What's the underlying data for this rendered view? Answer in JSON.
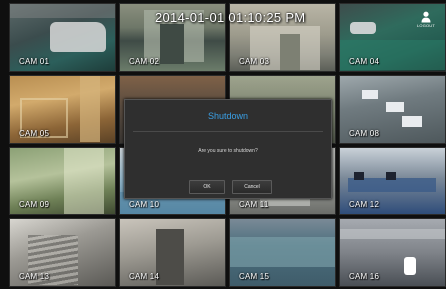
{
  "timestamp": "2014-01-01 01:10:25 PM",
  "logout": {
    "label": "LOGOUT",
    "icon": "user-icon"
  },
  "cameras": [
    {
      "label": "CAM 01"
    },
    {
      "label": "CAM 02"
    },
    {
      "label": "CAM 03"
    },
    {
      "label": "CAM 04"
    },
    {
      "label": "CAM 05"
    },
    {
      "label": ""
    },
    {
      "label": ""
    },
    {
      "label": "CAM 08"
    },
    {
      "label": "CAM 09"
    },
    {
      "label": "CAM 10"
    },
    {
      "label": "CAM 11"
    },
    {
      "label": "CAM 12"
    },
    {
      "label": "CAM 13"
    },
    {
      "label": "CAM 14"
    },
    {
      "label": "CAM 15"
    },
    {
      "label": "CAM 16"
    }
  ],
  "dialog": {
    "title": "Shutdown",
    "message": "Are you sure to shutdown?",
    "ok_label": "OK",
    "cancel_label": "Cancel"
  },
  "colors": {
    "dialog_title": "#3aa0e6",
    "dialog_bg": "#2f2f2f"
  }
}
